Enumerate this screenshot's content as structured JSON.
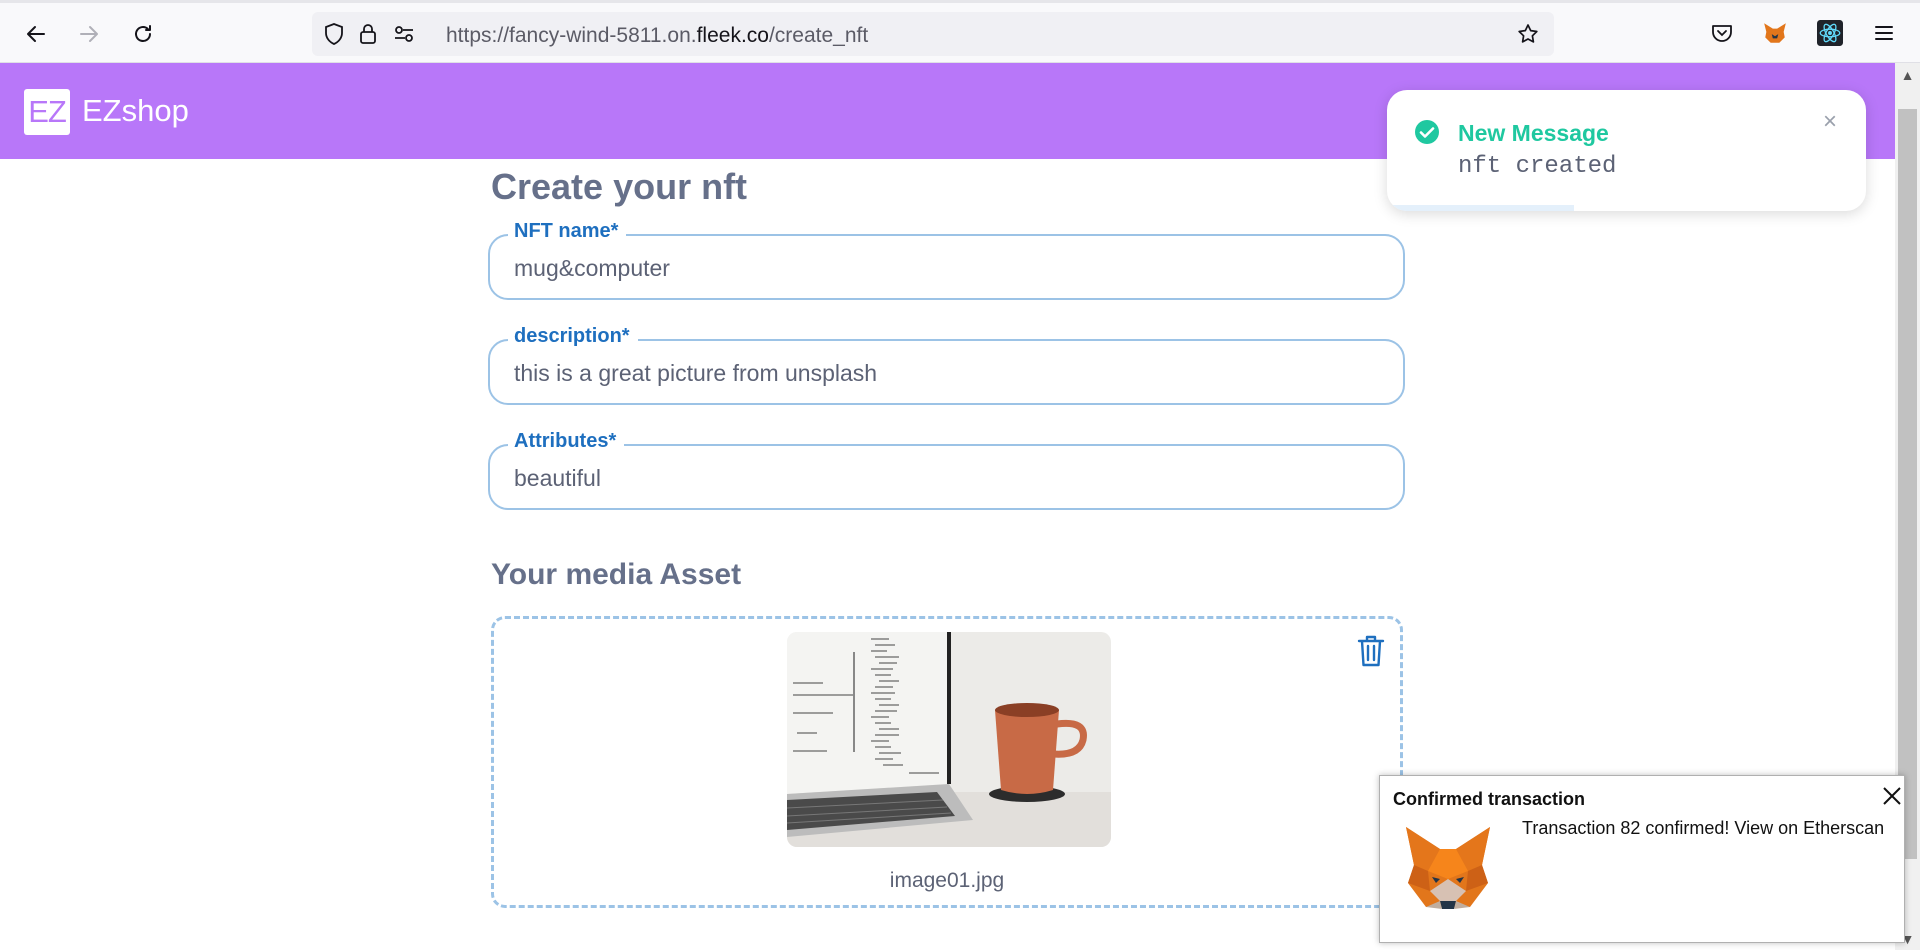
{
  "browser": {
    "url_prefix": "https://fancy-wind-5811.on.",
    "url_domain": "fleek.co",
    "url_path": "/create_nft"
  },
  "app": {
    "logo": "EZ",
    "brand": "EZshop"
  },
  "form": {
    "title": "Create your nft",
    "fields": [
      {
        "label": "NFT name*",
        "value": "mug&computer"
      },
      {
        "label": "description*",
        "value": "this is a great picture from unsplash"
      },
      {
        "label": "Attributes*",
        "value": "beautiful"
      }
    ]
  },
  "media": {
    "title": "Your media Asset",
    "filename": "image01.jpg"
  },
  "toast": {
    "title": "New Message",
    "message": "nft created",
    "close": "×",
    "progress": 0.39,
    "accent": "#1fc8a0"
  },
  "metamask": {
    "title": "Confirmed transaction",
    "body": "Transaction 82 confirmed! View on Etherscan"
  },
  "colors": {
    "header": "#b877f9",
    "field_border": "#9cc3e6",
    "label": "#1e6fbf",
    "title": "#66708a"
  }
}
